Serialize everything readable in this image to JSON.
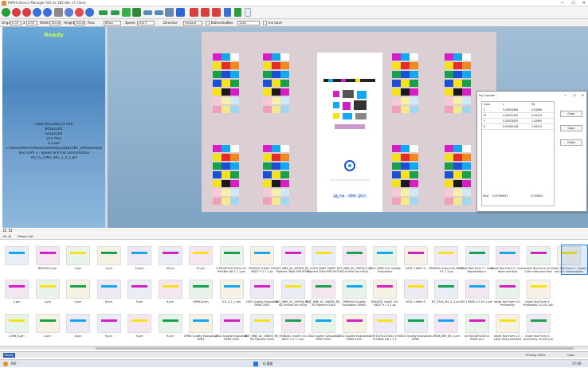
{
  "window": {
    "title": "RIPHX Device Manager RIO Vx 1B5 Win x7 Client",
    "minimize_glyph": "—",
    "maximize_glyph": "☐",
    "close_glyph": "✕"
  },
  "toolbar2": {
    "origin_label": "Origin",
    "origin_x": "0.00",
    "origin_unit": "X",
    "origin_y": "0.00",
    "width_label": "Width",
    "width_value": "100.00",
    "height_label": "Height",
    "height_value": "100.00",
    "pass_label": "Pass",
    "pass_value": "8Pass",
    "speed_label": "Speed",
    "speed_value": "Unit 2",
    "direction_label": "Direction",
    "direction_value": "Forward",
    "bidirection_label": "Bidirection",
    "res_label": "Res",
    "res_value": "1440",
    "ink_label": "Ink Save"
  },
  "left_panel": {
    "status": "Ready",
    "info_lines": [
      "1300.00x1300.21 mm",
      "605x1205",
      "Grayscale",
      "255 Pass",
      "4 Color",
      "C:\\Users\\Administrator\\Desktop\\240831MT_8PASS\\Inkjet",
      "Tool Form 3 - Speed and Ink Consumption",
      "V4_CS_CMIS_WG_1_3_1.prt"
    ]
  },
  "dialog": {
    "title": "Ink Counter",
    "col_color": "Color",
    "col_l": "L",
    "col_ml": "ML",
    "rows": [
      {
        "color": "C",
        "l": "0.00634989",
        "ml": "0.91868"
      },
      {
        "color": "M",
        "l": "0.00552463",
        "ml": "0.05415"
      },
      {
        "color": "Y",
        "l": "0.00925835",
        "ml": "1.92690"
      },
      {
        "color": "K",
        "l": "0.00083448",
        "ml": "1.96915"
      }
    ],
    "total_label": "Total",
    "total_l": "0.00780653",
    "total_ml": "21.90604",
    "btn_clear": "Clear",
    "btn_copy": "Copy",
    "btn_close": "Close"
  },
  "paper": {
    "strip_text": "ᎯᎿᏁᎭ - ᏒᏒᎻ ᎯᏒᏁ"
  },
  "bottom": {
    "tab_all": "All (4)",
    "tab_history": "History List",
    "thumbs_row1": [
      "",
      "BR4455-0.prn",
      "0.prn",
      "1.prn",
      "10.prn",
      "10.prn",
      "12.prn",
      "3-9E1675c215415-nf+ PrintBar HB 1 1 1.prt",
      "95462SC InkeJT cOL NED7 9 1 1 1.ps",
      "BOT_MBE_AC_GREEN_RV_FI Pigment 2NLb PSR.9OTV",
      "2002 SNB7 ONRTF Pigment 2NLb PSR.9OTV",
      "BOT_MBE_AC_CRESCO_GL SD Ordinal Ink+4Grp",
      "2002 OREG+02 Quality Evaluation",
      "2002 +4Wil+0",
      "95462SC Inkjet cOL NED7 9 1 1 1.ps",
      "Inkjet Tool Form 3 - Color Registration x",
      "Inkjet Tool Form 3 - Color Head and Row",
      "Inkjet Tool Form 10 - Color Head and Row",
      "Inkjet Tool Form 3 - Speed and Ink Consumption"
    ],
    "thumbs_row2": [
      "2.prn",
      "1.prn",
      "4.prn",
      "8.prn",
      "9.prn",
      "9.prn",
      "DPBX-8.prn",
      "3-0_2_1_2.prn",
      "2002 Quality Evaluation DPBX 2002",
      "BOT_MBE_AC_GREEN_RV_FI SD Ordinal Ink+4Grp",
      "BOT_MBE_AC_GREEN_RV_FI SD Pigment 2NLb",
      "OR00000 Quality Evaluation 00000",
      "95462SC InkeJT cOL NED7 9 1 1 1.ps",
      "2002 +4Wil+0",
      "BT_CRLS_M1_3_2.prn",
      "NT 1 PASS 0.5 V3.1.prn",
      "Inkjet Tool Form 23 - Printability",
      "Inkjet Tool Form 3 - Printability 10.101.prn"
    ],
    "thumbs_row3": [
      "2396_8.prn",
      "3.prn",
      "8.prn",
      "9.prn",
      "9.prn",
      "9.prn",
      "DPBX Quality Evaluation DPBX",
      "2002 Quality Evaluation DPBX 2002",
      "BOT_MBE_AC_GREEN_RV_FI SD Pigment 2NLb",
      "95462SC InkeJT cOL NED7 9 1 1 1.ps",
      "2002 Quality Evaluation DPBX 2002",
      "2002 Quality Evaluation DPBX 2002",
      "3-9E1675c215415 nf+ PrintBar HB 1 1 1",
      "2002 Quality Evaluation DPBX",
      "DMAR_BM_EN_3.prn",
      "ns+BL9-8F4U0211 PINHL.prn",
      "Inkjet Tool Form 13 - Color Head and Row",
      "Inkjet Tool Form 3 - Uniformity 10.220.prn"
    ],
    "status_left": "Ready",
    "status_right": "Printing 100%",
    "status_open": "Open"
  },
  "taskbar": {
    "start_label": "RIP",
    "search_placeholder": "Q 搜索",
    "clock": "17:09"
  },
  "colors": {
    "cyan": "#12a8f0",
    "magenta": "#d51ec4",
    "yellow": "#f6e21a",
    "black": "#1a1a1a",
    "green": "#19a04a",
    "blue": "#1c4fd4",
    "red": "#e62b2b",
    "orange": "#f08a1e",
    "ready_green": "#c8ff4a"
  }
}
